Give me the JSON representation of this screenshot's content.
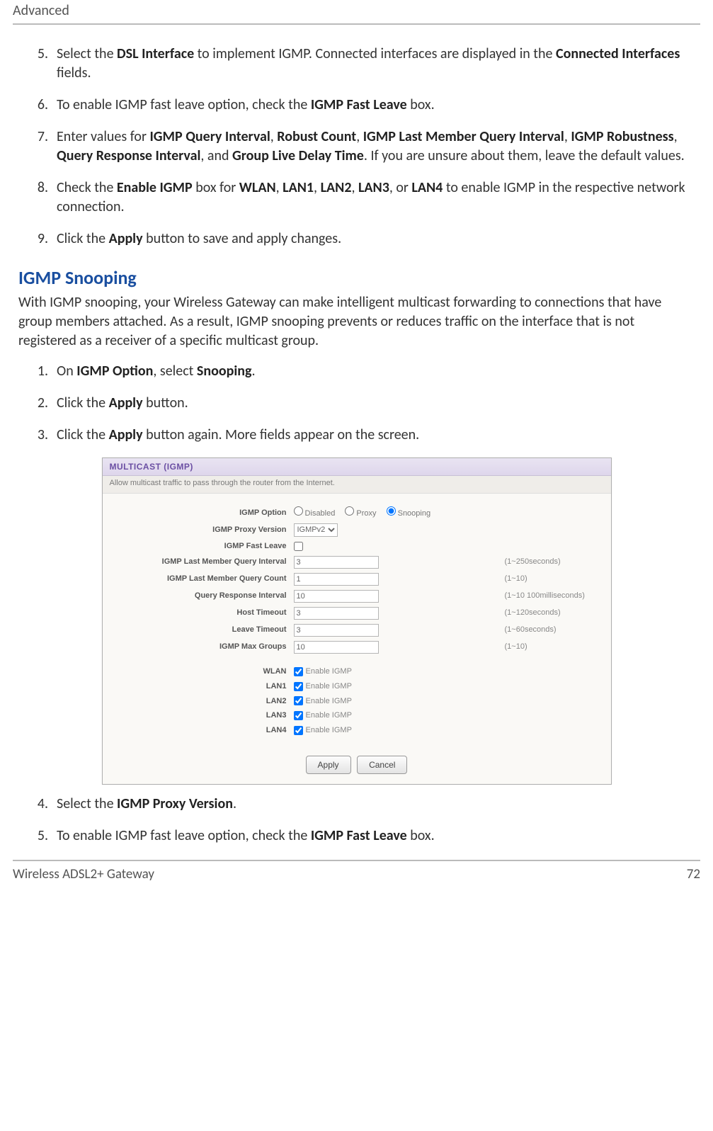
{
  "header": {
    "title": "Advanced"
  },
  "steps1": [
    {
      "n": "5.",
      "html": [
        "Select the ",
        {
          "b": "DSL Interface"
        },
        " to implement IGMP. Connected interfaces are displayed in the ",
        {
          "b": "Connected Interfaces"
        },
        " fields."
      ]
    },
    {
      "n": "6.",
      "html": [
        "To enable IGMP fast leave option, check the ",
        {
          "b": "IGMP Fast Leave"
        },
        " box."
      ]
    },
    {
      "n": "7.",
      "html": [
        "Enter values for ",
        {
          "b": "IGMP Query Interval"
        },
        ", ",
        {
          "b": "Robust Count"
        },
        ", ",
        {
          "b": "IGMP Last Member Query Interval"
        },
        ", ",
        {
          "b": "IGMP Robustness"
        },
        ", ",
        {
          "b": "Query Response Interval"
        },
        ", and ",
        {
          "b": "Group Live Delay Time"
        },
        ". If you are unsure about them, leave the default values."
      ]
    },
    {
      "n": "8.",
      "html": [
        "Check the ",
        {
          "b": "Enable IGMP"
        },
        " box for ",
        {
          "b": "WLAN"
        },
        ", ",
        {
          "b": "LAN1"
        },
        ", ",
        {
          "b": "LAN2"
        },
        ", ",
        {
          "b": "LAN3"
        },
        ", or ",
        {
          "b": "LAN4"
        },
        " to enable IGMP in the respective network connection."
      ]
    },
    {
      "n": "9.",
      "html": [
        "Click the ",
        {
          "b": "Apply"
        },
        " button to save and apply changes."
      ]
    }
  ],
  "section": {
    "title": "IGMP Snooping",
    "intro": "With IGMP snooping, your Wireless Gateway can make intelligent multicast forwarding to connections that have group members attached. As a result, IGMP snooping prevents or reduces traffic on the interface that is not registered as a receiver of a specific multicast group."
  },
  "steps2a": [
    {
      "n": "1.",
      "html": [
        "On ",
        {
          "b": "IGMP Option"
        },
        ", select ",
        {
          "b": "Snooping"
        },
        "."
      ]
    },
    {
      "n": "2.",
      "html": [
        "Click the ",
        {
          "b": "Apply"
        },
        " button."
      ]
    },
    {
      "n": "3.",
      "html": [
        "Click the ",
        {
          "b": "Apply"
        },
        " button again. More fields appear on the screen."
      ]
    }
  ],
  "panel": {
    "title": "MULTICAST (IGMP)",
    "subtitle": "Allow multicast traffic to pass through the router from the Internet.",
    "options": {
      "igmp_option_label": "IGMP Option",
      "radios": [
        {
          "label": "Disabled",
          "checked": false
        },
        {
          "label": "Proxy",
          "checked": false
        },
        {
          "label": "Snooping",
          "checked": true
        }
      ],
      "proxy_version_label": "IGMP Proxy Version",
      "proxy_version_value": "IGMPv2",
      "fast_leave_label": "IGMP Fast Leave",
      "fast_leave_checked": false,
      "fields": [
        {
          "label": "IGMP Last Member Query Interval",
          "value": "3",
          "hint": "(1~250seconds)"
        },
        {
          "label": "IGMP Last Member Query Count",
          "value": "1",
          "hint": "(1~10)"
        },
        {
          "label": "Query Response Interval",
          "value": "10",
          "hint": "(1~10 100milliseconds)"
        },
        {
          "label": "Host Timeout",
          "value": "3",
          "hint": "(1~120seconds)"
        },
        {
          "label": "Leave Timeout",
          "value": "3",
          "hint": "(1~60seconds)"
        },
        {
          "label": "IGMP Max Groups",
          "value": "10",
          "hint": "(1~10)"
        }
      ],
      "interfaces": [
        {
          "label": "WLAN",
          "text": "Enable IGMP",
          "checked": true
        },
        {
          "label": "LAN1",
          "text": "Enable IGMP",
          "checked": true
        },
        {
          "label": "LAN2",
          "text": "Enable IGMP",
          "checked": true
        },
        {
          "label": "LAN3",
          "text": "Enable IGMP",
          "checked": true
        },
        {
          "label": "LAN4",
          "text": "Enable IGMP",
          "checked": true
        }
      ],
      "buttons": {
        "apply": "Apply",
        "cancel": "Cancel"
      }
    }
  },
  "steps2b": [
    {
      "n": "4.",
      "html": [
        "Select the ",
        {
          "b": "IGMP Proxy Version"
        },
        "."
      ]
    },
    {
      "n": "5.",
      "html": [
        "To enable IGMP fast leave option, check the ",
        {
          "b": "IGMP Fast Leave"
        },
        " box."
      ]
    }
  ],
  "footer": {
    "left": "Wireless ADSL2+ Gateway",
    "right": "72"
  }
}
